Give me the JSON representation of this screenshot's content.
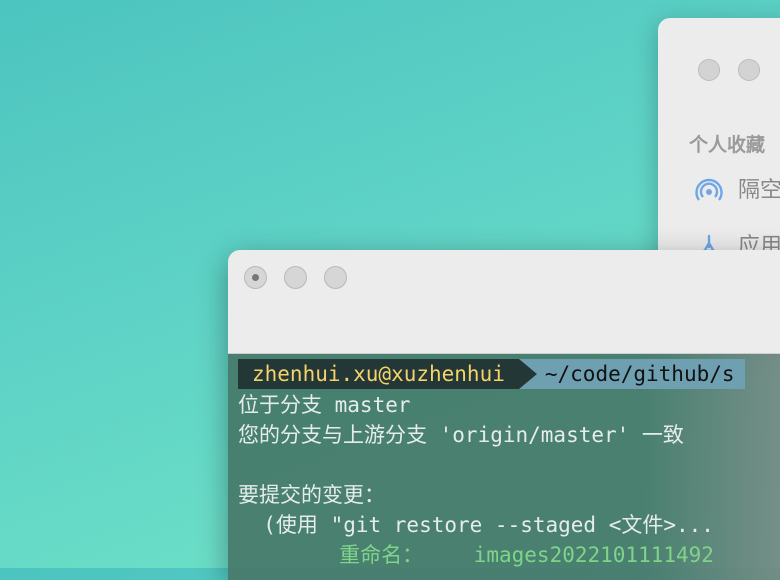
{
  "finder": {
    "section_title": "个人收藏",
    "items": [
      {
        "icon": "airdrop-icon",
        "label": "隔空投送"
      },
      {
        "icon": "applications-icon",
        "label": "应用程序"
      }
    ]
  },
  "terminal": {
    "prompt": {
      "user_host": "zhenhui.xu@xuzhenhui",
      "path": "~/code/github/s"
    },
    "lines": [
      "位于分支 master",
      "您的分支与上游分支 'origin/master' 一致",
      "",
      "要提交的变更：",
      "  (使用 \"git restore --staged <文件>...",
      "        重命名：    images2022101111492"
    ]
  },
  "colors": {
    "prompt_user_bg": "#243737",
    "prompt_user_fg": "#f5d36b",
    "prompt_path_bg": "#6ea0b1",
    "renamed_fg": "#7fd48a"
  }
}
